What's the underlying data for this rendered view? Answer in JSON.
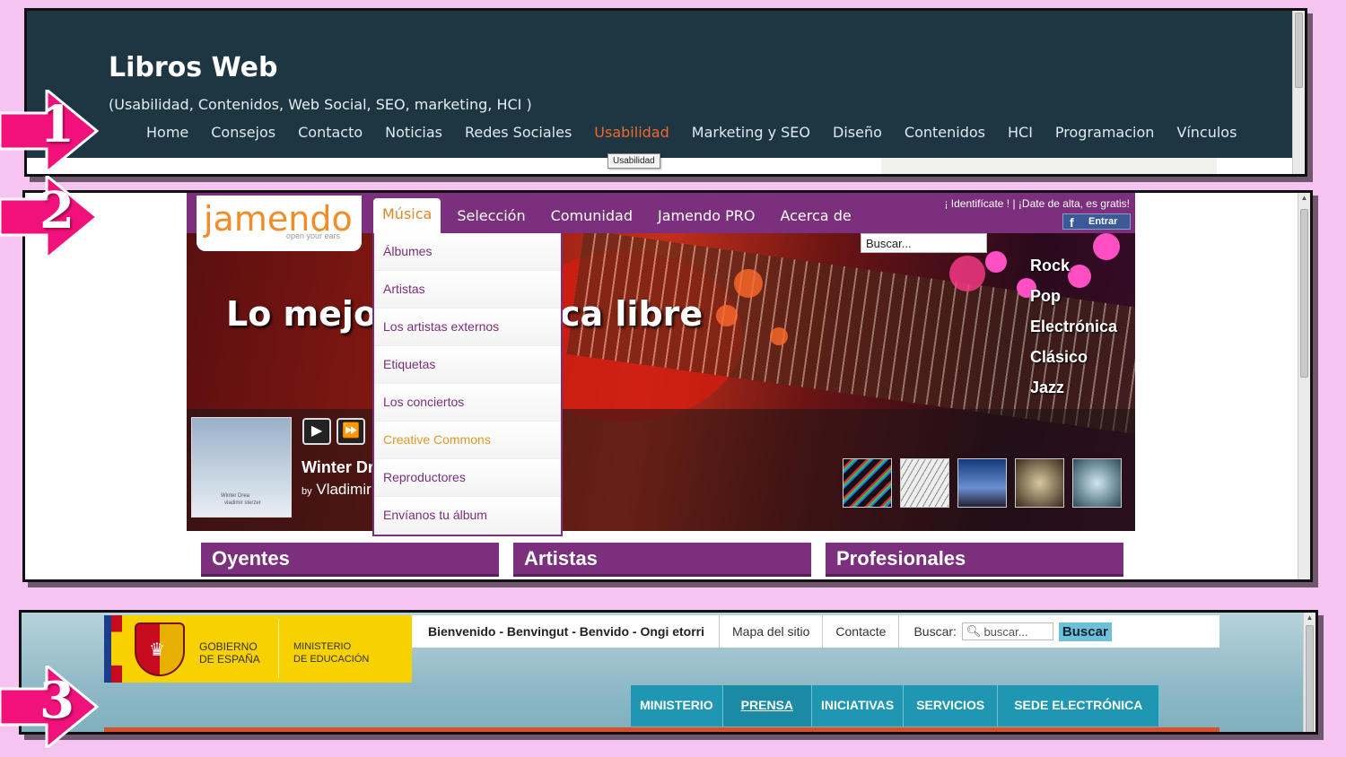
{
  "panel1": {
    "site_title": "Libros Web",
    "subtitle": "(Usabilidad, Contenidos, Web Social, SEO, marketing, HCI )",
    "nav": [
      "Home",
      "Consejos",
      "Contacto",
      "Noticias",
      "Redes Sociales",
      "Usabilidad",
      "Marketing y SEO",
      "Diseño",
      "Contenidos",
      "HCI",
      "Programacion",
      "Vínculos"
    ],
    "active_nav": "Usabilidad",
    "tooltip": "Usabilidad",
    "colors": {
      "header_bg": "#1d3642",
      "active": "#f0682b"
    }
  },
  "panel2": {
    "logo": "jamendo",
    "logo_tagline": "open your ears",
    "menu": [
      "Música",
      "Selección",
      "Comunidad",
      "Jamendo PRO",
      "Acerca de"
    ],
    "login_text": "¡ Identifícate ! | ¡Date de alta, es gratis!",
    "fb_button": "Entrar",
    "search_placeholder": "Buscar...",
    "headline_left": "Lo mejor",
    "headline_right": "ca libre",
    "genres": [
      "Rock",
      "Pop",
      "Electrónica",
      "Clásico",
      "Jazz"
    ],
    "dropdown": [
      "Álbumes",
      "Artistas",
      "Los artistas externos",
      "Etiquetas",
      "Los conciertos",
      "Creative Commons",
      "Reproductores",
      "Envíanos tu álbum"
    ],
    "player": {
      "song": "Winter Dr",
      "by": "by",
      "artist": "Vladimir",
      "art_line1": "Winter Drea",
      "art_line2": "vladimir sterzer"
    },
    "sections": [
      "Oyentes",
      "Artistas",
      "Profesionales"
    ],
    "colors": {
      "brand": "#7b2f7c",
      "logo": "#f28c28"
    }
  },
  "panel3": {
    "gov_line1": "GOBIERNO",
    "gov_line2": "DE ESPAÑA",
    "min_line1": "MINISTERIO",
    "min_line2": "DE EDUCACIÓN",
    "greeting": "Bienvenido  -  Benvingut  -  Benvido  -  Ongi etorri",
    "links": [
      "Mapa del sitio",
      "Contacte"
    ],
    "search_label": "Buscar:",
    "search_placeholder": "buscar...",
    "search_button": "Buscar",
    "tabs": [
      "MINISTERIO",
      "PRENSA",
      "INICIATIVAS",
      "SERVICIOS",
      "SEDE ELECTRÓNICA"
    ],
    "selected_tab": "PRENSA",
    "colors": {
      "tabs": "#1f97b3",
      "gov_yellow": "#f8d100"
    }
  },
  "arrows": [
    "1",
    "2",
    "3"
  ]
}
